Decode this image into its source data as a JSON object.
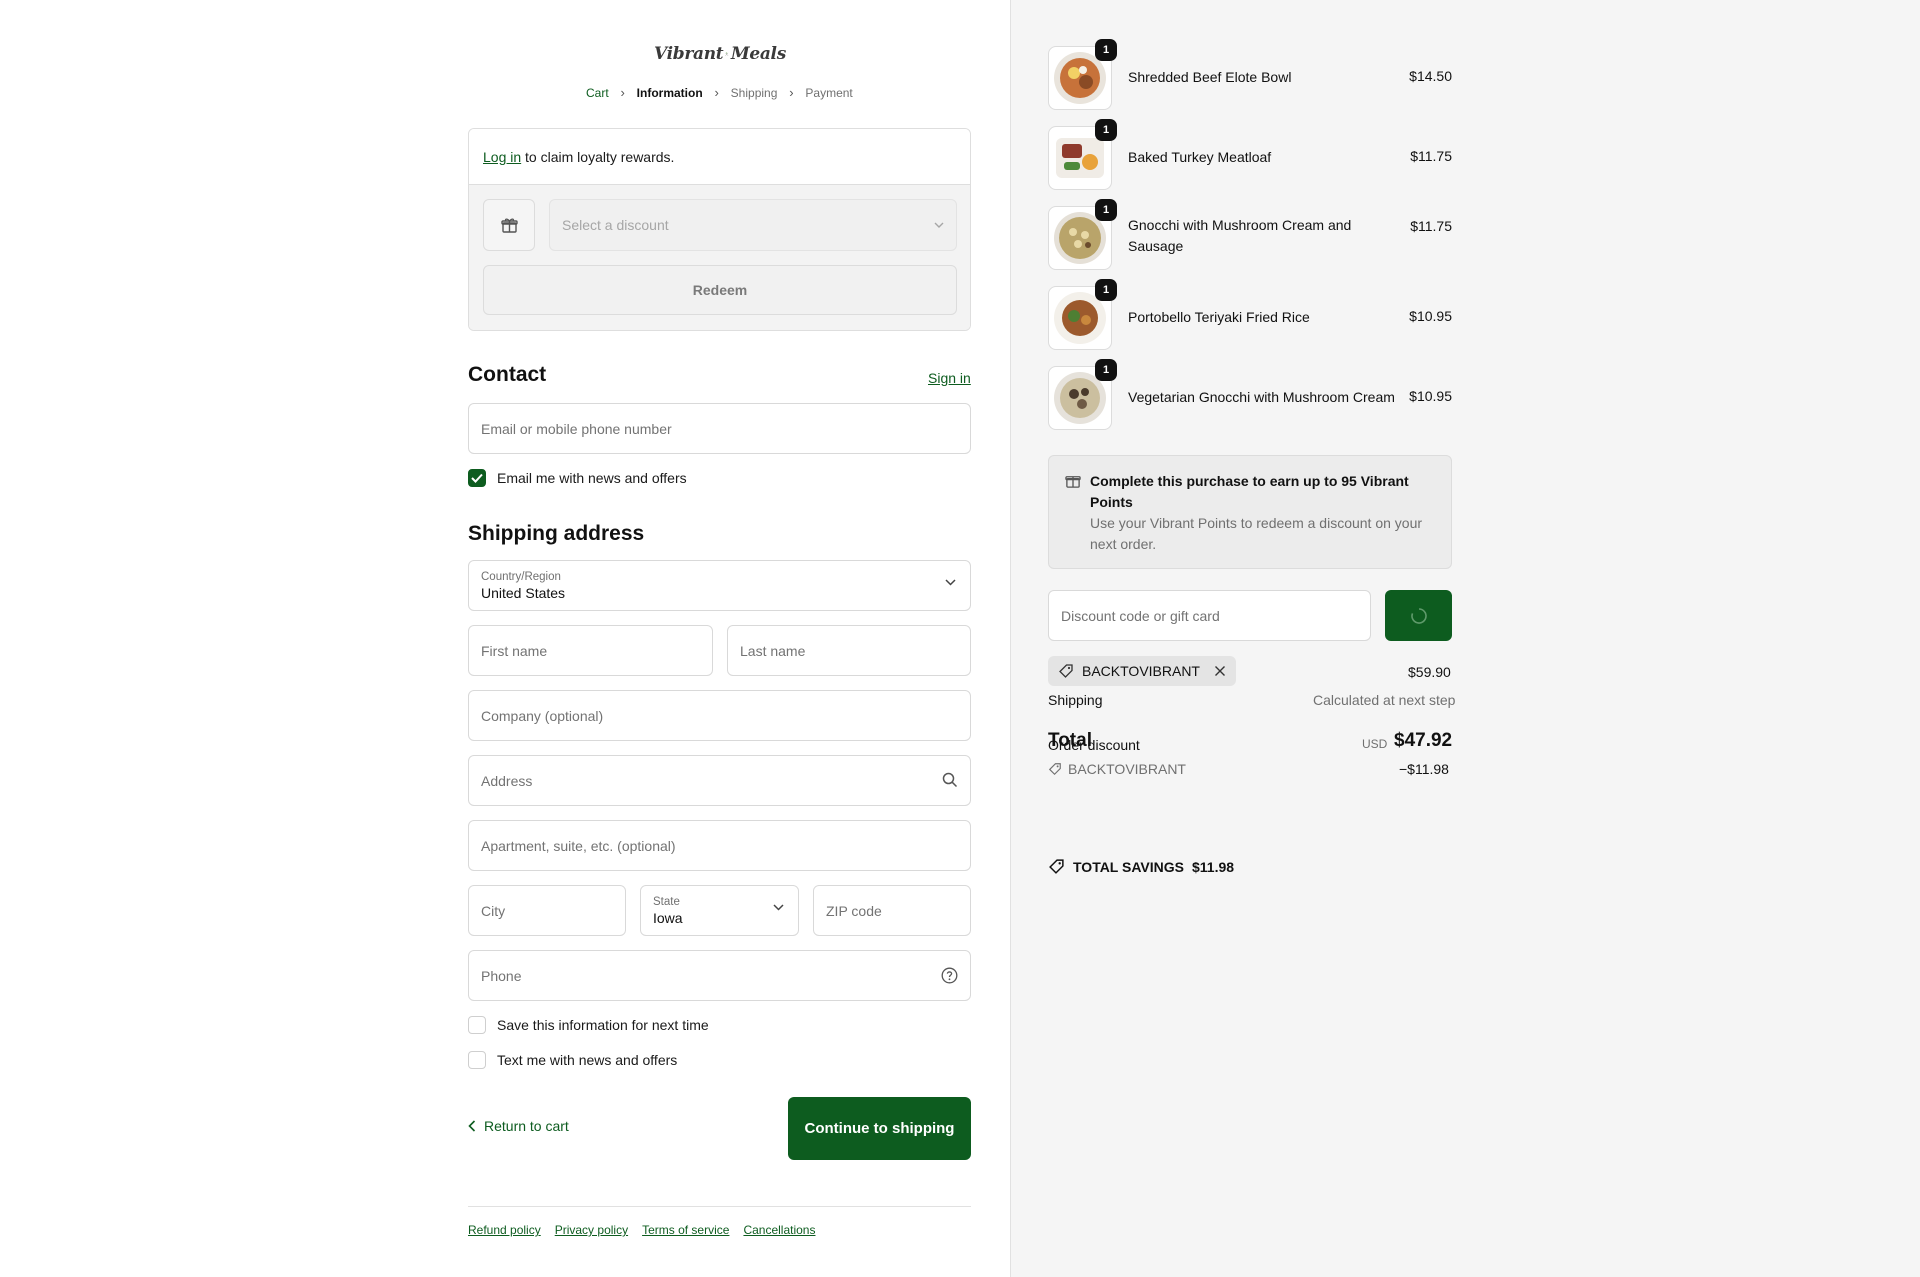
{
  "brand": {
    "word1": "Vibrant",
    "word2": "Meals",
    "accent": "#0d5c1f"
  },
  "breadcrumb": [
    {
      "label": "Cart",
      "state": "link"
    },
    {
      "label": "Information",
      "state": "active"
    },
    {
      "label": "Shipping",
      "state": "inactive"
    },
    {
      "label": "Payment",
      "state": "inactive"
    }
  ],
  "loyalty": {
    "login_link": "Log in",
    "login_text": "to claim loyalty rewards.",
    "discount_placeholder": "Select a discount",
    "redeem_label": "Redeem"
  },
  "contact": {
    "heading": "Contact",
    "sign_in": "Sign in",
    "email_placeholder": "Email or mobile phone number",
    "email_news_label": "Email me with news and offers",
    "email_news_checked": true
  },
  "shipping": {
    "heading": "Shipping address",
    "country_label": "Country/Region",
    "country_value": "United States",
    "first_name": "First name",
    "last_name": "Last name",
    "company": "Company (optional)",
    "address": "Address",
    "apartment": "Apartment, suite, etc. (optional)",
    "city": "City",
    "state_label": "State",
    "state_value": "Iowa",
    "zip": "ZIP code",
    "phone": "Phone",
    "save_info_label": "Save this information for next time",
    "text_news_label": "Text me with news and offers"
  },
  "actions": {
    "return_label": "Return to cart",
    "continue_label": "Continue to shipping"
  },
  "footer": [
    "Refund policy",
    "Privacy policy",
    "Terms of service",
    "Cancellations"
  ],
  "order": {
    "items": [
      {
        "name": "Shredded Beef Elote Bowl",
        "price": "$14.50",
        "qty": "1"
      },
      {
        "name": "Baked Turkey Meatloaf",
        "price": "$11.75",
        "qty": "1"
      },
      {
        "name": "Gnocchi with Mushroom Cream and Sausage",
        "price": "$11.75",
        "qty": "1"
      },
      {
        "name": "Portobello Teriyaki Fried Rice",
        "price": "$10.95",
        "qty": "1"
      },
      {
        "name": "Vegetarian Gnocchi with Mushroom Cream",
        "price": "$10.95",
        "qty": "1"
      }
    ],
    "points_title": "Complete this purchase to earn up to 95 Vibrant Points",
    "points_sub": "Use your Vibrant Points to redeem a discount on your next order.",
    "code_placeholder": "Discount code or gift card",
    "applied_code": "BACKTOVIBRANT",
    "subtotal": "$59.90",
    "shipping_label": "Shipping",
    "shipping_value": "Calculated at next step",
    "order_discount_label": "Order discount",
    "discount_code": "BACKTOVIBRANT",
    "discount_value": "−$11.98",
    "total_label": "Total",
    "currency": "USD",
    "total_value": "$47.92",
    "savings_label": "TOTAL SAVINGS",
    "savings_value": "$11.98"
  }
}
